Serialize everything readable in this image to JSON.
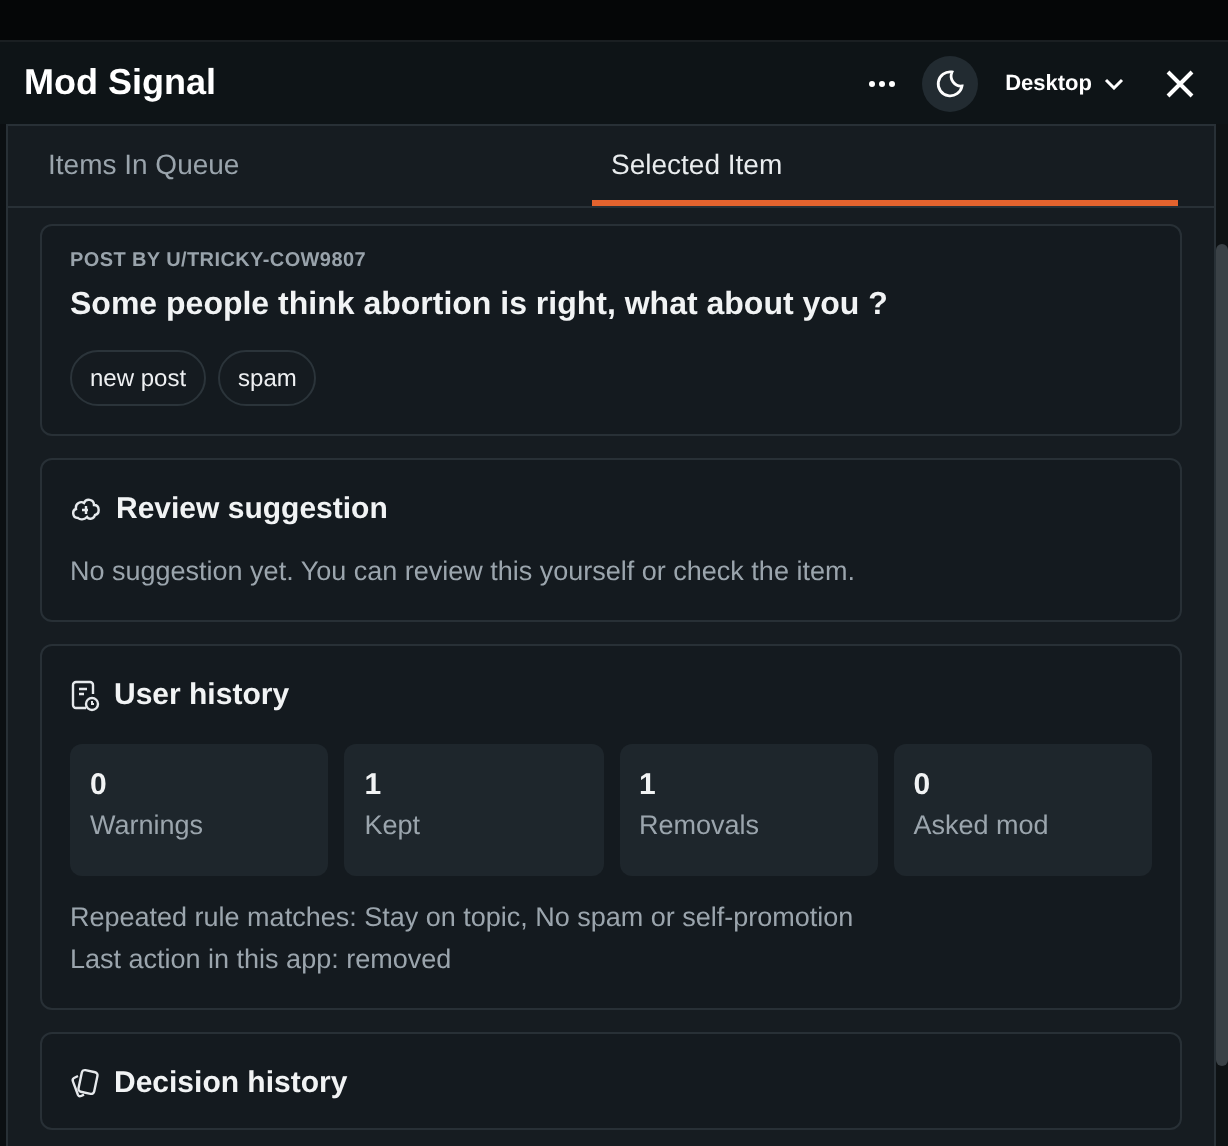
{
  "window": {
    "title": "Mod Signal",
    "view_menu": "Desktop"
  },
  "tabs": [
    {
      "label": "Items In Queue",
      "selected": false
    },
    {
      "label": "Selected Item",
      "selected": true
    }
  ],
  "post": {
    "byline": "POST BY U/TRICKY-COW9807",
    "title": "Some people think abortion is right, what about you ?",
    "tags": [
      "new post",
      "spam"
    ]
  },
  "sections": [
    {
      "kind": "suggestion",
      "title": "Review suggestion",
      "text": "No suggestion yet. You can review this yourself or check the item."
    },
    {
      "kind": "history",
      "title": "User history",
      "stats": [
        {
          "value": "0",
          "label": "Warnings"
        },
        {
          "value": "1",
          "label": "Kept"
        },
        {
          "value": "1",
          "label": "Removals"
        },
        {
          "value": "0",
          "label": "Asked mod"
        }
      ],
      "lines": [
        "Repeated rule matches: Stay on topic, No spam or self-promotion",
        "Last action in this app: removed"
      ]
    },
    {
      "kind": "decisions",
      "title": "Decision history"
    }
  ]
}
